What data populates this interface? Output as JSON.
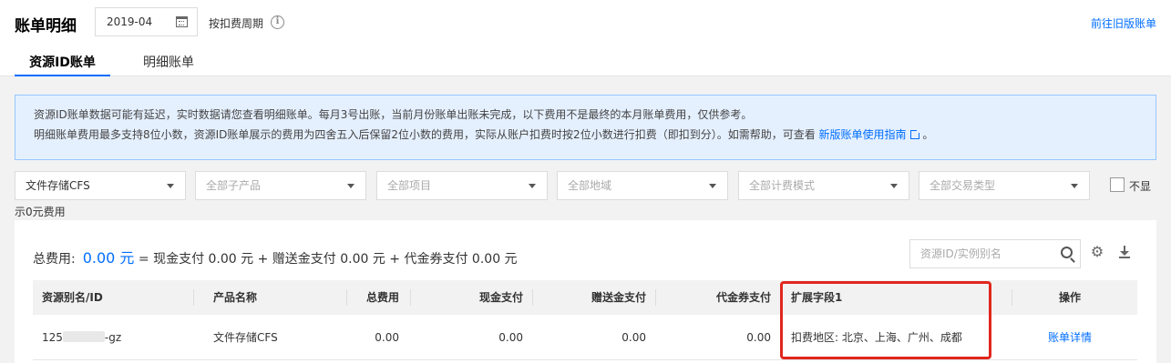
{
  "header": {
    "title": "账单明细",
    "date_value": "2019-04",
    "cycle_label": "按扣费周期",
    "old_version_link": "前往旧版账单"
  },
  "tabs": [
    {
      "label": "资源ID账单",
      "active": true
    },
    {
      "label": "明细账单",
      "active": false
    }
  ],
  "notice": {
    "line1": "资源ID账单数据可能有延迟，实时数据请您查看明细账单。每月3号出账，当前月份账单出账未完成，以下费用不是最终的本月账单费用，仅供参考。",
    "line2_prefix": "明细账单费用最多支持8位小数，资源ID账单展示的费用为四舍五入后保留2位小数的费用，实际从账户扣费时按2位小数进行扣费（即扣到分）。如需帮助，可查看",
    "guide_link": "新版账单使用指南",
    "line2_suffix": "。"
  },
  "filters": {
    "product": "文件存储CFS",
    "sub_product_placeholder": "全部子产品",
    "project_placeholder": "全部项目",
    "region_placeholder": "全部地域",
    "billing_mode_placeholder": "全部计费模式",
    "transaction_type_placeholder": "全部交易类型",
    "hide_zero_label_a": "不显",
    "hide_zero_label_b": "示0元费用"
  },
  "summary": {
    "total_label": "总费用:",
    "total_amount": "0.00 元",
    "formula": "= 现金支付 0.00 元 + 赠送金支付 0.00 元 + 代金券支付 0.00 元"
  },
  "search": {
    "placeholder": "资源ID/实例别名"
  },
  "table": {
    "columns": [
      "资源别名/ID",
      "产品名称",
      "总费用",
      "现金支付",
      "赠送金支付",
      "代金券支付",
      "扩展字段1",
      "操作"
    ],
    "rows": [
      {
        "id_prefix": "125",
        "id_suffix": "-gz",
        "product": "文件存储CFS",
        "total": "0.00",
        "cash": "0.00",
        "gift": "0.00",
        "voucher": "0.00",
        "ext1": "扣费地区: 北京、上海、广州、成都",
        "action": "账单详情"
      }
    ]
  },
  "colors": {
    "accent": "#006eff",
    "highlight": "#e0271e",
    "notice_bg": "#e5f0ff"
  }
}
